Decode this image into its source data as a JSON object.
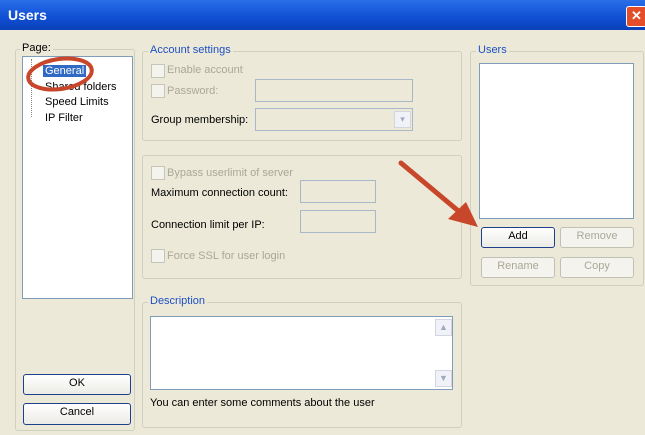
{
  "window": {
    "title": "Users",
    "close_glyph": "✕"
  },
  "pages": {
    "legend": "Page:",
    "items": [
      "General",
      "Shared folders",
      "Speed Limits",
      "IP Filter"
    ],
    "selected": "General"
  },
  "account": {
    "legend": "Account settings",
    "enable_account": "Enable account",
    "password": "Password:",
    "password_value": "",
    "group_membership": "Group membership:",
    "group_value": ""
  },
  "limits": {
    "bypass": "Bypass userlimit of server",
    "max_conn": "Maximum connection count:",
    "max_conn_value": "",
    "conn_per_ip": "Connection limit per IP:",
    "conn_per_ip_value": "",
    "force_ssl": "Force SSL for user login"
  },
  "description": {
    "legend": "Description",
    "hint": "You can enter some comments about the user"
  },
  "users": {
    "legend": "Users",
    "add": "Add",
    "remove": "Remove",
    "rename": "Rename",
    "copy": "Copy"
  },
  "buttons": {
    "ok": "OK",
    "cancel": "Cancel"
  },
  "colors": {
    "annotation": "#c8462a",
    "selection": "#316ac5",
    "titlebar": "#0f4fd3"
  }
}
